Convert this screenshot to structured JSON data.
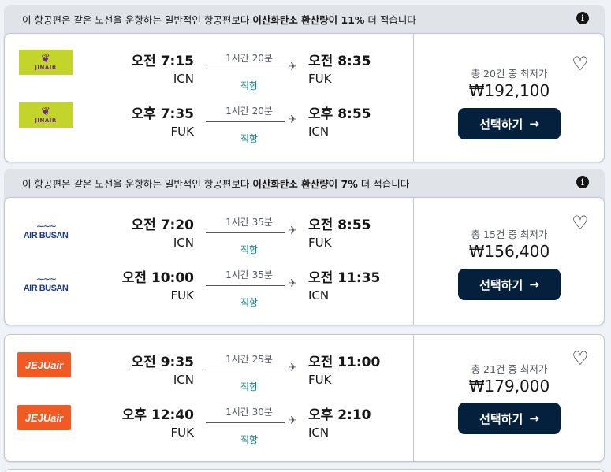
{
  "results": [
    {
      "eco_notice": {
        "prefix": "이 항공편은 같은 노선을 운항하는 일반적인 항공편보다 ",
        "bold": "이산화탄소 환산량이 11%",
        "suffix": " 더 적습니다"
      },
      "legs": [
        {
          "airline": "JINAIR",
          "logo_type": "jinair",
          "dep_time": "오전 7:15",
          "dep_code": "ICN",
          "duration": "1시간 20분",
          "stops": "직항",
          "arr_time": "오전 8:35",
          "arr_code": "FUK"
        },
        {
          "airline": "JINAIR",
          "logo_type": "jinair",
          "dep_time": "오후 7:35",
          "dep_code": "FUK",
          "duration": "1시간 20분",
          "stops": "직항",
          "arr_time": "오후 8:55",
          "arr_code": "ICN"
        }
      ],
      "total_label": "총 20건 중 최저가",
      "price": "₩192,100",
      "select_label": "선택하기",
      "arrow": "→"
    },
    {
      "eco_notice": {
        "prefix": "이 항공편은 같은 노선을 운항하는 일반적인 항공편보다 ",
        "bold": "이산화탄소 환산량이 7%",
        "suffix": " 더 적습니다"
      },
      "legs": [
        {
          "airline": "AIR BUSAN",
          "logo_type": "busan",
          "dep_time": "오전 7:20",
          "dep_code": "ICN",
          "duration": "1시간 35분",
          "stops": "직항",
          "arr_time": "오전 8:55",
          "arr_code": "FUK"
        },
        {
          "airline": "AIR BUSAN",
          "logo_type": "busan",
          "dep_time": "오전 10:00",
          "dep_code": "FUK",
          "duration": "1시간 35분",
          "stops": "직항",
          "arr_time": "오전 11:35",
          "arr_code": "ICN"
        }
      ],
      "total_label": "총 15건 중 최저가",
      "price": "₩156,400",
      "select_label": "선택하기",
      "arrow": "→"
    },
    {
      "legs": [
        {
          "airline": "JEJUair",
          "logo_type": "jeju",
          "dep_time": "오전 9:35",
          "dep_code": "ICN",
          "duration": "1시간 25분",
          "stops": "직항",
          "arr_time": "오전 11:00",
          "arr_code": "FUK"
        },
        {
          "airline": "JEJUair",
          "logo_type": "jeju",
          "dep_time": "오후 12:40",
          "dep_code": "FUK",
          "duration": "1시간 30분",
          "stops": "직항",
          "arr_time": "오후 2:10",
          "arr_code": "ICN"
        }
      ],
      "total_label": "총 21건 중 최저가",
      "price": "₩179,000",
      "select_label": "선택하기",
      "arrow": "→"
    }
  ],
  "icons": {
    "info": "i",
    "heart": "♡",
    "plane": "✈",
    "jinair_mark": "❦"
  },
  "colors": {
    "button_bg": "#05203c",
    "direct_text": "#0c838a",
    "jinair_brand": "#c3d52a",
    "jeju_brand": "#f15a22",
    "busan_brand": "#1a3a8c"
  }
}
